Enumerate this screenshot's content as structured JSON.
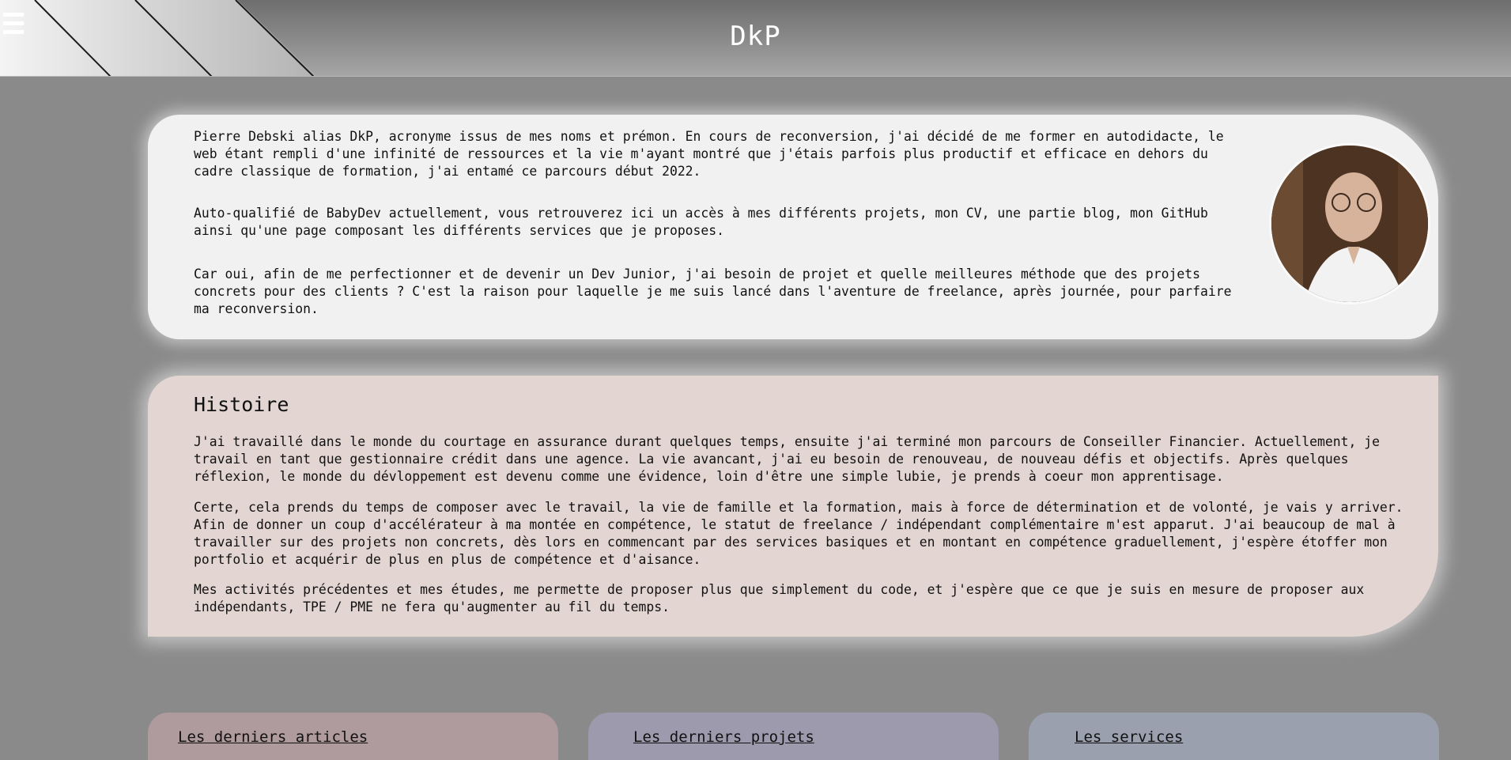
{
  "header": {
    "title": "DkP",
    "menu_icon": "hamburger-menu-icon"
  },
  "intro": {
    "paragraphs": [
      "Pierre Debski alias DkP, acronyme issus de mes noms et prémon. En cours de reconversion, j'ai décidé de me former en autodidacte, le web étant rempli d'une infinité de ressources et la vie m'ayant montré que j'étais parfois plus productif et efficace en dehors du cadre classique de formation, j'ai entamé ce parcours début 2022.",
      "Auto-qualifié de BabyDev actuellement, vous retrouverez ici un accès à mes différents projets, mon CV, une partie blog, mon GitHub ainsi qu'une page composant les différents services que je proposes.",
      "Car oui, afin de me perfectionner et de devenir un Dev Junior, j'ai besoin de projet et quelle meilleures méthode que des projets concrets pour des clients ? C'est la raison pour laquelle je me suis lancé dans l'aventure de freelance, après journée, pour parfaire ma reconversion."
    ]
  },
  "histoire": {
    "title": "Histoire",
    "paragraphs": [
      "J'ai travaillé dans le monde du courtage en assurance durant quelques temps, ensuite j'ai terminé mon parcours de Conseiller Financier. Actuellement, je travail en tant que gestionnaire crédit dans une agence. La vie avancant, j'ai eu besoin de renouveau, de nouveau défis et objectifs. Après quelques réflexion, le monde du dévloppement est devenu comme une évidence, loin d'être une simple lubie, je prends à coeur mon apprentisage.",
      "Certe, cela prends du temps de composer avec le travail, la vie de famille et la formation, mais à force de détermination et de volonté, je vais y arriver. Afin de donner un coup d'accélérateur à ma montée en compétence, le statut de freelance / indépendant complémentaire m'est apparut. J'ai beaucoup de mal à travailler sur des projets non concrets, dès lors en commencant par des services basiques et en montant en compétence graduellement, j'espère étoffer mon portfolio et acquérir de plus en plus de compétence et d'aisance.",
      "Mes activités précédentes et mes études, me permette de proposer plus que simplement du code, et j'espère que ce que je suis en mesure de proposer aux indépendants, TPE / PME ne fera qu'augmenter au fil du temps."
    ]
  },
  "cards": [
    {
      "label": "Les derniers articles",
      "color": "#af9a9e"
    },
    {
      "label": "Les derniers projets",
      "color": "#9d9aad"
    },
    {
      "label": "Les services",
      "color": "#9aa0ae"
    }
  ]
}
